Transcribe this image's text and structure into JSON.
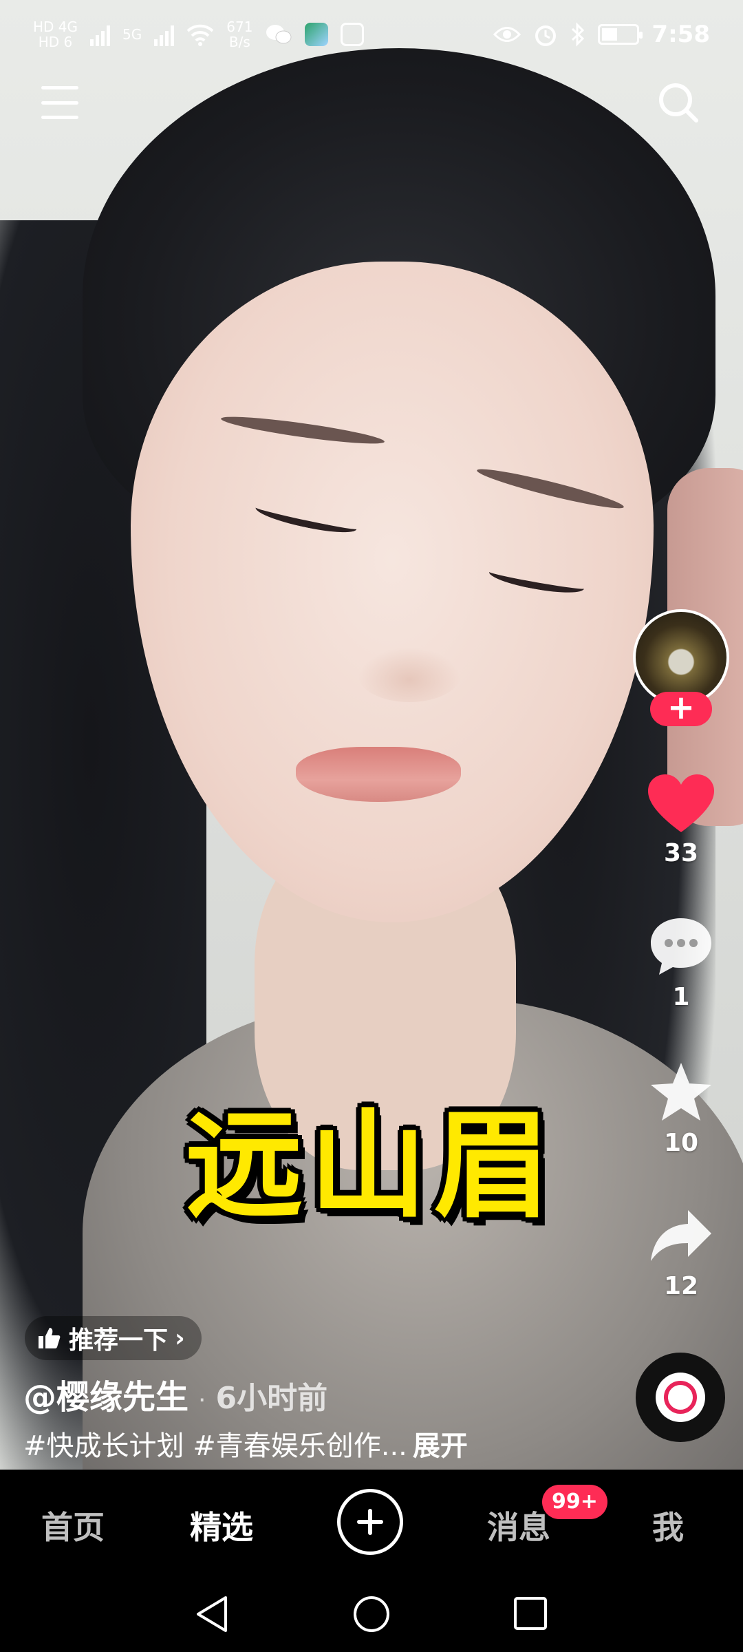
{
  "status_bar": {
    "network_left_top": "HD 4G",
    "network_left_bottom": "HD 6",
    "network_5g": "5G",
    "speed_value": "671",
    "speed_unit": "B/s",
    "time": "7:58"
  },
  "top_bar": {
    "menu_icon": "menu-icon",
    "search_icon": "search-icon"
  },
  "video": {
    "caption": "远山眉"
  },
  "side_actions": {
    "follow_symbol": "+",
    "like_count": "33",
    "comment_count": "1",
    "favorite_count": "10",
    "share_count": "12",
    "like_color": "#fe2c55"
  },
  "info": {
    "recommend_label": "推荐一下",
    "recommend_chevron": "›",
    "author": "@樱缘先生",
    "separator": "·",
    "time_ago": "6小时前",
    "description": "#快成长计划 #青春娱乐创作...",
    "expand_label": "展开"
  },
  "bottom_nav": {
    "tabs": [
      {
        "label": "首页"
      },
      {
        "label": "精选"
      },
      {
        "label": "消息"
      },
      {
        "label": "我"
      }
    ],
    "messages_badge": "99+",
    "accent_color": "#fe2c55"
  }
}
